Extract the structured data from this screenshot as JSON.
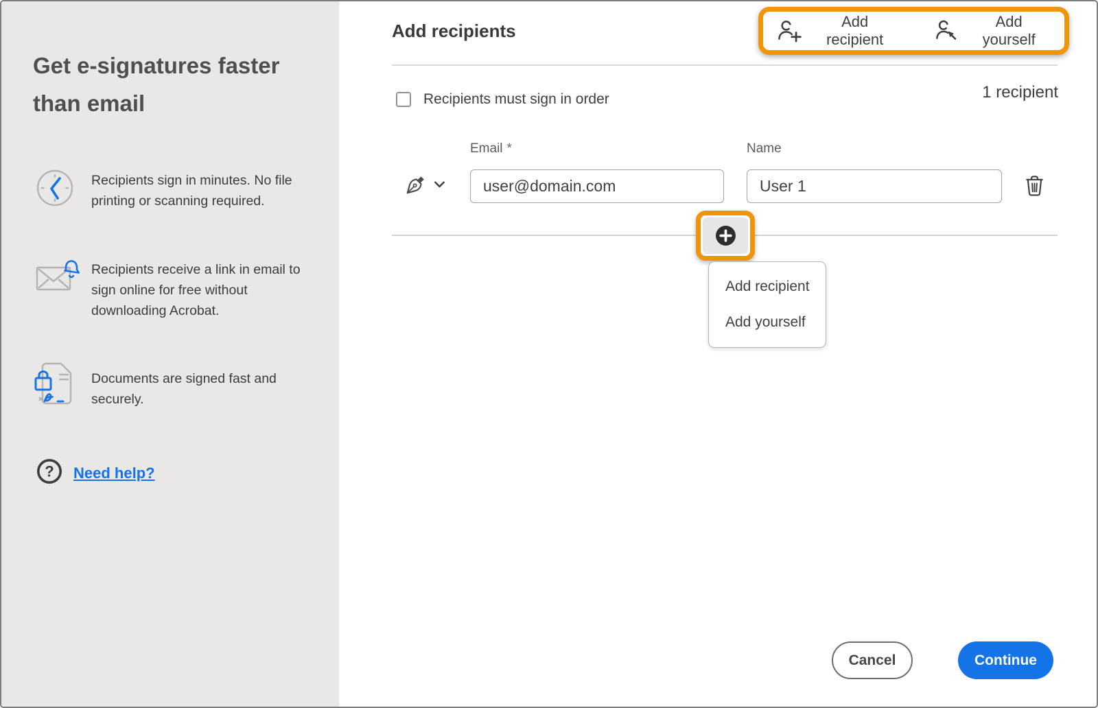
{
  "sidebar": {
    "heading": "Get e-signatures faster than email",
    "features": [
      {
        "icon": "clock-icon",
        "text": "Recipients sign in minutes. No file printing or scanning required."
      },
      {
        "icon": "mail-notification-icon",
        "text": "Recipients receive a link in email to sign online for free without downloading Acrobat."
      },
      {
        "icon": "secure-document-icon",
        "text": "Documents are signed fast and securely."
      }
    ],
    "help_link": "Need help?"
  },
  "header": {
    "title": "Add recipients",
    "add_recipient": "Add recipient",
    "add_yourself": "Add yourself"
  },
  "recipients": {
    "order_checkbox_label": "Recipients must sign in order",
    "count": "1 recipient",
    "rows": [
      {
        "email_label": "Email",
        "required_mark": "*",
        "email": "user@domain.com",
        "name_label": "Name",
        "name": "User 1"
      }
    ]
  },
  "add_menu": {
    "items": [
      {
        "label": "Add recipient"
      },
      {
        "label": "Add yourself"
      }
    ]
  },
  "footer": {
    "cancel": "Cancel",
    "continue": "Continue"
  },
  "colors": {
    "accent_blue": "#1473E6",
    "highlight_orange": "#F0940A",
    "sidebar_gray": "#e9e8e7"
  }
}
